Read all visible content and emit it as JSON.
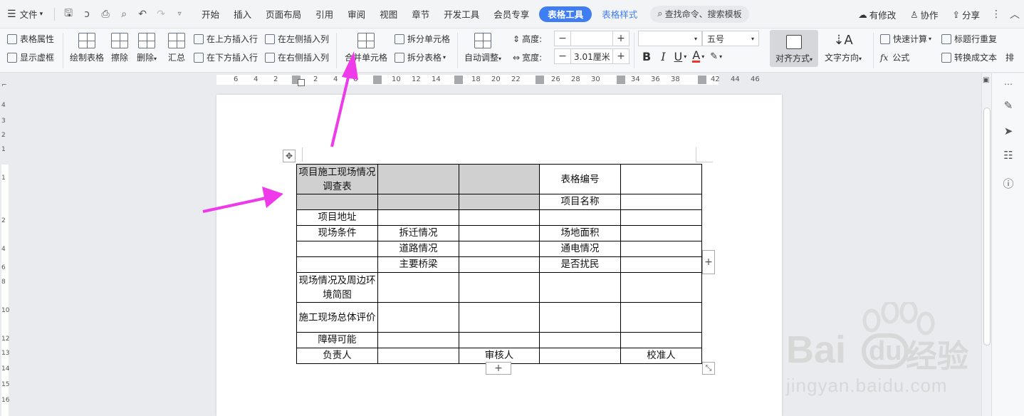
{
  "menubar": {
    "file_label": "文件",
    "tabs": [
      "开始",
      "插入",
      "页面布局",
      "引用",
      "审阅",
      "视图",
      "章节",
      "开发工具",
      "会员专享"
    ],
    "active_tab": "表格工具",
    "tab_table_style": "表格样式",
    "search_placeholder": "查找命令、搜索模板",
    "modified_label": "有修改",
    "collab_label": "协作",
    "share_label": "分享"
  },
  "ribbon": {
    "table_props": "表格属性",
    "show_gridlines": "显示虚框",
    "draw_table": "绘制表格",
    "erase": "擦除",
    "delete": "删除",
    "summary": "汇总",
    "insert_above": "在上方插入行",
    "insert_below": "在下方插入行",
    "insert_left": "在左侧插入列",
    "insert_right": "在右侧插入列",
    "merge_cells": "合并单元格",
    "split_cells": "拆分单元格",
    "split_table": "拆分表格",
    "auto_fit": "自动调整",
    "height_label": "高度:",
    "height_value": "",
    "width_label": "宽度:",
    "width_value": "3.01厘米",
    "font_name": "",
    "font_size": "五号",
    "align": "对齐方式",
    "text_direction": "文字方向",
    "quick_calc": "快速计算",
    "formula": "公式",
    "header_repeat": "标题行重复",
    "convert_text": "转换成文本",
    "sort_partial": "排"
  },
  "ruler": {
    "ticks": [
      "6",
      "4",
      "2",
      "2",
      "4",
      "6",
      "10",
      "12",
      "14",
      "18",
      "20",
      "22",
      "26",
      "28",
      "30",
      "34",
      "36",
      "38",
      "42",
      "44",
      "46"
    ]
  },
  "vruler": {
    "ticks": [
      "4",
      "3",
      "2",
      "1",
      "1",
      "2",
      "4",
      "6",
      "8",
      "10",
      "12",
      "13",
      "14",
      "15",
      "16"
    ]
  },
  "table": {
    "r1": [
      "项目施工现场情况调查表",
      "",
      "",
      "表格编号",
      ""
    ],
    "r2": [
      "",
      "",
      "",
      "项目名称",
      ""
    ],
    "r3": [
      "项目地址",
      "",
      "",
      "",
      ""
    ],
    "r4": [
      "现场条件",
      "拆迁情况",
      "",
      "场地面积",
      ""
    ],
    "r5": [
      "",
      "道路情况",
      "",
      "通电情况",
      ""
    ],
    "r6": [
      "",
      "主要桥梁",
      "",
      "是否扰民",
      ""
    ],
    "r7": [
      "现场情况及周边环境简图",
      "",
      "",
      "",
      ""
    ],
    "r8": [
      "施工现场总体评价",
      "",
      "",
      "",
      ""
    ],
    "r9": [
      "障碍可能",
      "",
      "",
      "",
      ""
    ],
    "r10": [
      "负责人",
      "",
      "审核人",
      "",
      "校准人"
    ]
  },
  "watermark": {
    "brand": "Bai",
    "brand_cn": "经验",
    "url": "jingyan.baidu.com"
  },
  "colors": {
    "accent": "#3f7df3",
    "arrow": "#ee3ae8",
    "shaded_cell": "#d0d0d0"
  }
}
